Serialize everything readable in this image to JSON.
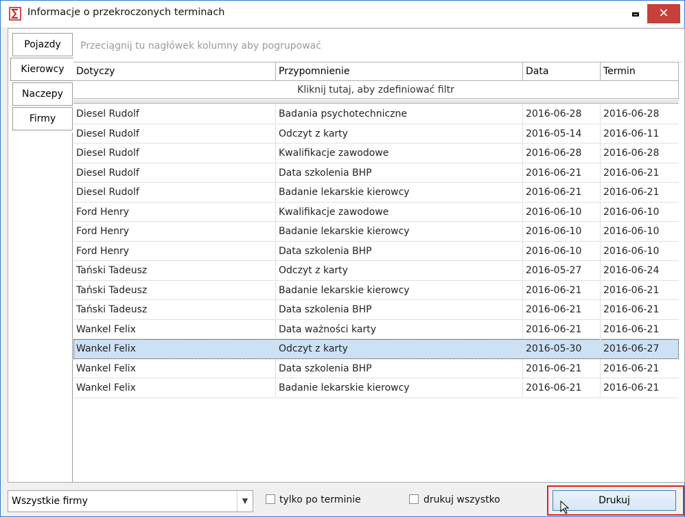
{
  "window": {
    "title": "Informacje o przekroczonych terminach",
    "close_glyph": "✕"
  },
  "tabs": [
    {
      "label": "Pojazdy",
      "active": false
    },
    {
      "label": "Kierowcy",
      "active": true
    },
    {
      "label": "Naczepy",
      "active": false
    },
    {
      "label": "Firmy",
      "active": false
    }
  ],
  "grid": {
    "group_hint": "Przeciągnij tu nagłówek kolumny aby pogrupować",
    "filter_hint": "Kliknij tutaj, aby zdefiniować filtr",
    "columns": [
      "Dotyczy",
      "Przypomnienie",
      "Data",
      "Termin"
    ],
    "rows": [
      [
        "Diesel Rudolf",
        "Badania psychotechniczne",
        "2016-06-28",
        "2016-06-28"
      ],
      [
        "Diesel Rudolf",
        "Odczyt z karty",
        "2016-05-14",
        "2016-06-11"
      ],
      [
        "Diesel Rudolf",
        "Kwalifikacje zawodowe",
        "2016-06-28",
        "2016-06-28"
      ],
      [
        "Diesel Rudolf",
        "Data szkolenia BHP",
        "2016-06-21",
        "2016-06-21"
      ],
      [
        "Diesel Rudolf",
        "Badanie lekarskie kierowcy",
        "2016-06-21",
        "2016-06-21"
      ],
      [
        "Ford Henry",
        "Kwalifikacje zawodowe",
        "2016-06-10",
        "2016-06-10"
      ],
      [
        "Ford Henry",
        "Badanie lekarskie kierowcy",
        "2016-06-10",
        "2016-06-10"
      ],
      [
        "Ford Henry",
        "Data szkolenia BHP",
        "2016-06-10",
        "2016-06-10"
      ],
      [
        "Tański Tadeusz",
        "Odczyt z karty",
        "2016-05-27",
        "2016-06-24"
      ],
      [
        "Tański Tadeusz",
        "Badanie lekarskie kierowcy",
        "2016-06-21",
        "2016-06-21"
      ],
      [
        "Tański Tadeusz",
        "Data szkolenia BHP",
        "2016-06-21",
        "2016-06-21"
      ],
      [
        "Wankel Felix",
        "Data ważności karty",
        "2016-06-21",
        "2016-06-21"
      ],
      [
        "Wankel Felix",
        "Odczyt z karty",
        "2016-05-30",
        "2016-06-27"
      ],
      [
        "Wankel Felix",
        "Data szkolenia BHP",
        "2016-06-21",
        "2016-06-21"
      ],
      [
        "Wankel Felix",
        "Badanie lekarskie kierowcy",
        "2016-06-21",
        "2016-06-21"
      ]
    ],
    "selected_row": 12
  },
  "bottom": {
    "company_select": "Wszystkie firmy",
    "only_overdue_label": "tylko po terminie",
    "print_all_label": "drukuj wszystko",
    "print_button": "Drukuj"
  },
  "colors": {
    "selection": "#cde1f5",
    "close_button": "#c7403a",
    "highlight_border": "#e02020"
  },
  "icons": {
    "app": "app-logo-icon",
    "minimize": "minimize-icon",
    "close": "close-icon",
    "dropdown": "chevron-down-icon",
    "cursor": "mouse-pointer-icon"
  }
}
